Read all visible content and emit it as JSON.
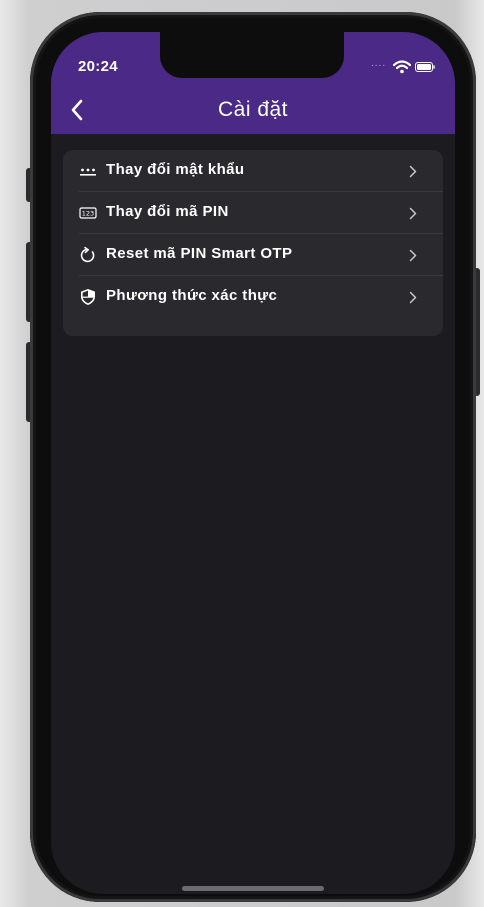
{
  "status_bar": {
    "time": "20:24",
    "signal_dots": "....",
    "icons": [
      "wifi-icon",
      "battery-icon"
    ]
  },
  "header": {
    "title": "Cài đặt",
    "back_icon": "chevron-left-icon",
    "background_color": "#4b2a87"
  },
  "settings": {
    "items": [
      {
        "label": "Thay đổi mật khẩu",
        "icon": "password-dots-icon"
      },
      {
        "label": "Thay đổi mã PIN",
        "icon": "pin-123-icon"
      },
      {
        "label": "Reset mã PIN Smart OTP",
        "icon": "reset-icon"
      },
      {
        "label": "Phương thức xác thực",
        "icon": "shield-icon"
      }
    ]
  },
  "colors": {
    "screen_background": "#1c1b1f",
    "card_background": "#2a292d",
    "accent": "#4b2a87",
    "text": "#ffffff"
  }
}
